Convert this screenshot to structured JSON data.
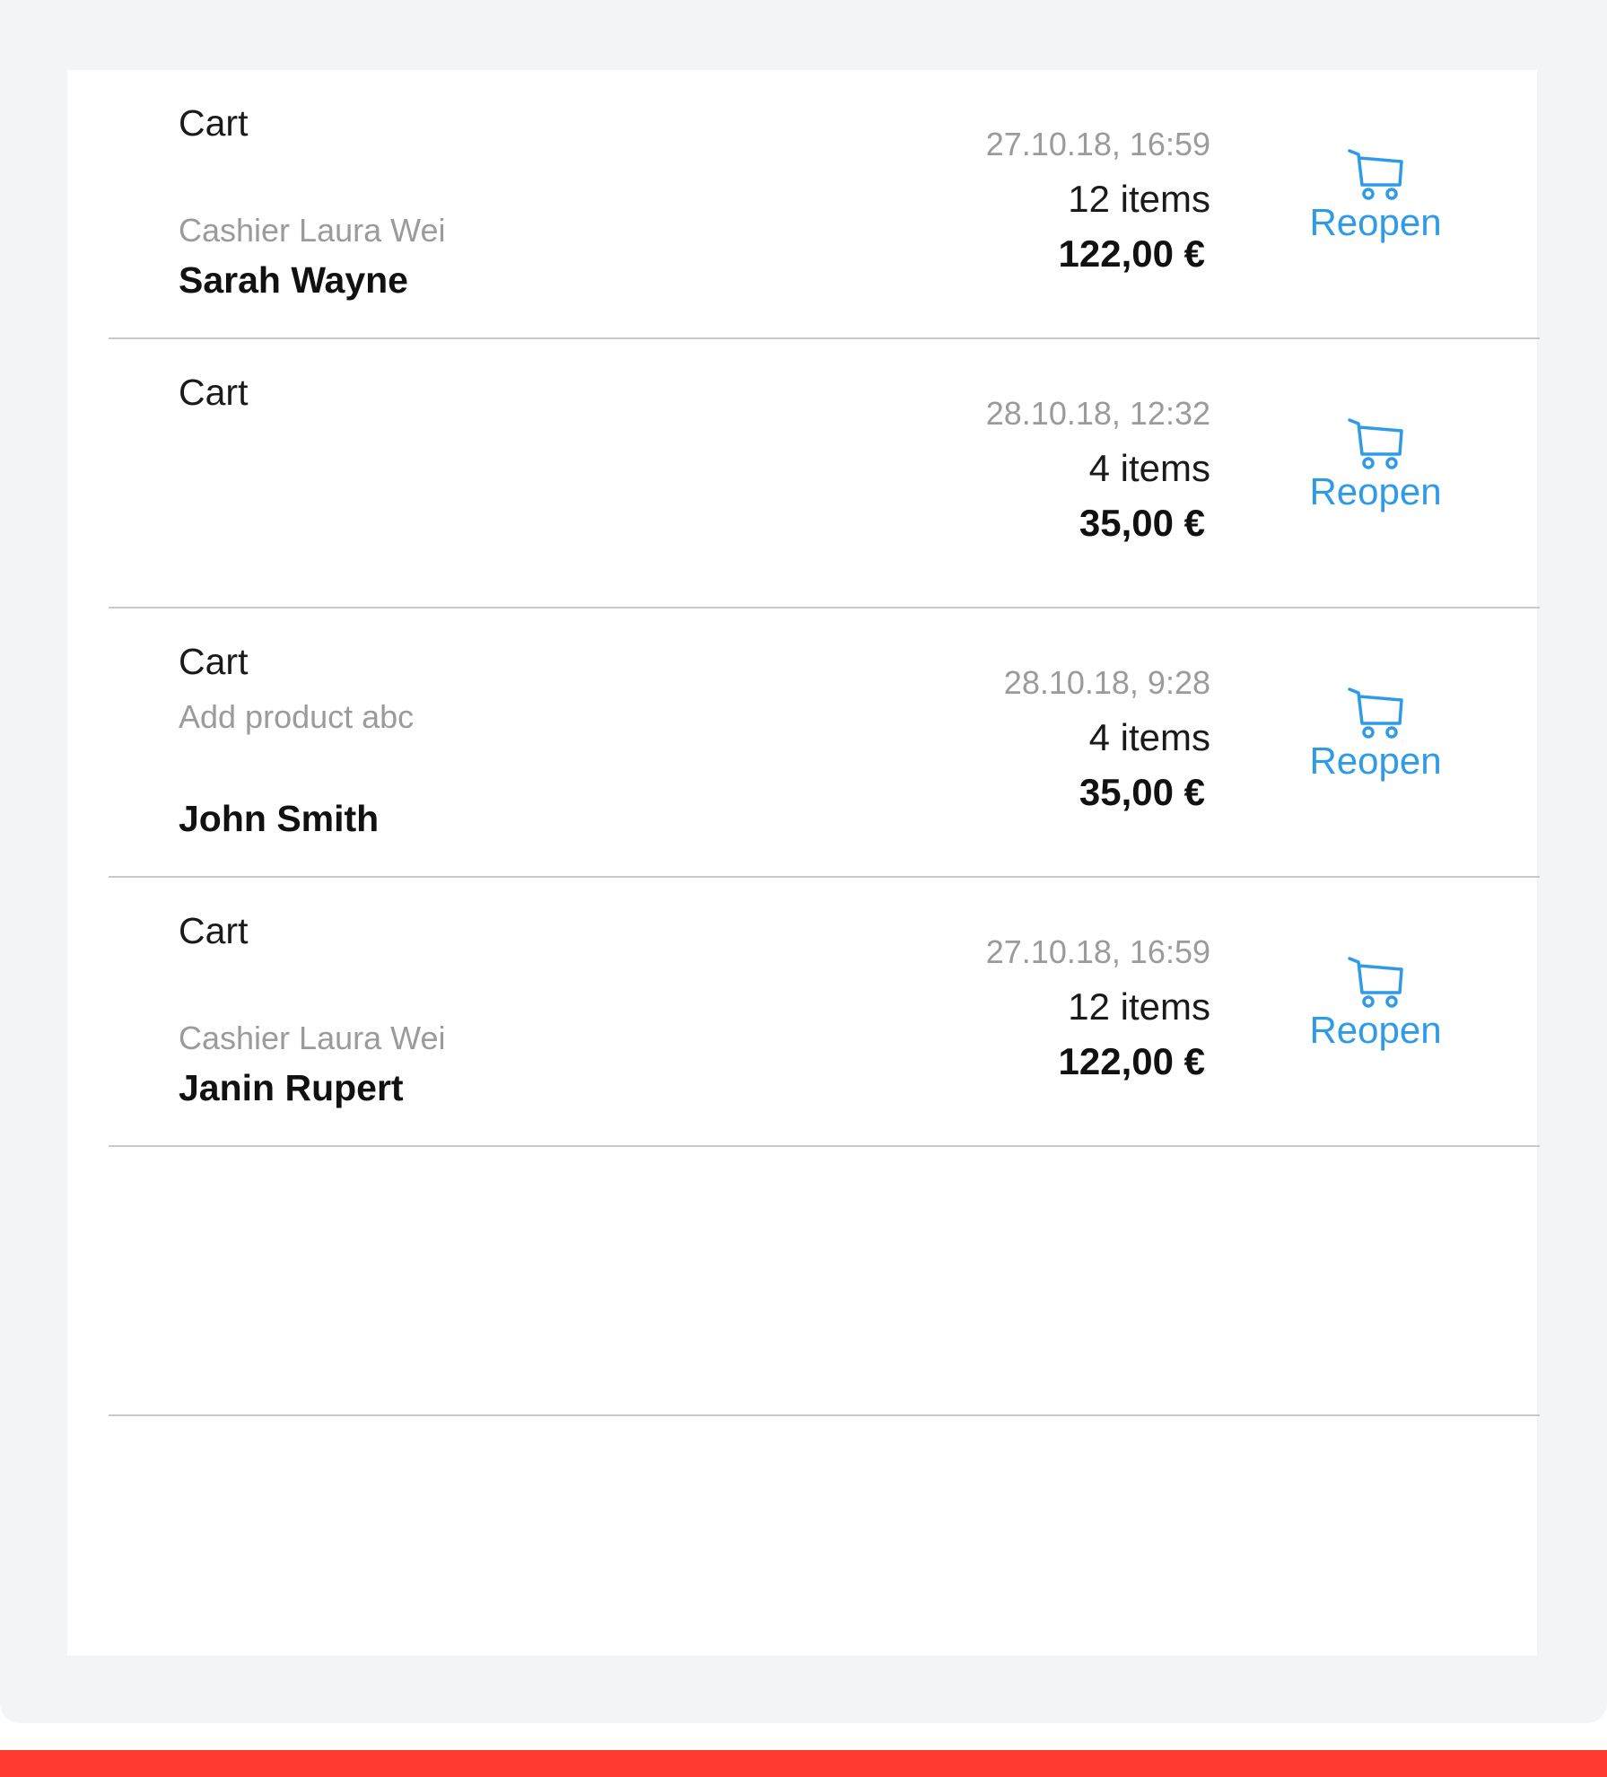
{
  "carts": [
    {
      "title": "Cart",
      "note": "",
      "cashier": "Cashier Laura Wei",
      "customer": "Sarah Wayne",
      "date": "27.10.18, 16:59",
      "items": "12 items",
      "total": "122,00 €",
      "action_label": "Reopen"
    },
    {
      "title": "Cart",
      "note": "",
      "cashier": "",
      "customer": "",
      "date": "28.10.18, 12:32",
      "items": "4 items",
      "total": "35,00 €",
      "action_label": "Reopen"
    },
    {
      "title": "Cart",
      "note": "Add product abc",
      "cashier": "",
      "customer": "John Smith",
      "date": "28.10.18, 9:28",
      "items": "4 items",
      "total": "35,00 €",
      "action_label": "Reopen"
    },
    {
      "title": "Cart",
      "note": "",
      "cashier": "Cashier Laura Wei",
      "customer": "Janin Rupert",
      "date": "27.10.18, 16:59",
      "items": "12 items",
      "total": "122,00 €",
      "action_label": "Reopen"
    }
  ],
  "icons": {
    "reopen": "shopping-cart-icon"
  },
  "colors": {
    "accent": "#2f9be6",
    "background": "#f3f4f6",
    "footer": "#ff3b30",
    "muted_text": "#9b9b9b",
    "divider": "#c5c9d2"
  }
}
